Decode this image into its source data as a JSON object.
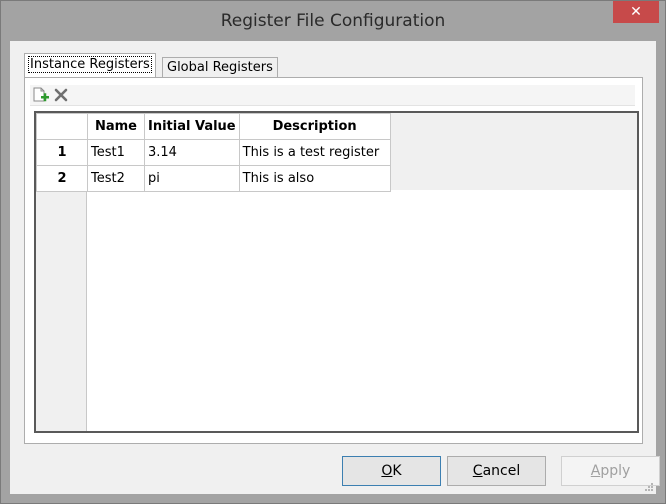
{
  "window": {
    "title": "Register File Configuration",
    "close_glyph": "✕"
  },
  "tabs": [
    {
      "label": "Instance Registers",
      "active": true
    },
    {
      "label": "Global Registers",
      "active": false
    }
  ],
  "toolbar": {
    "add_icon": "add-row-icon",
    "delete_icon": "delete-row-icon"
  },
  "grid": {
    "columns": [
      "Name",
      "Initial Value",
      "Description"
    ],
    "rows": [
      {
        "num": "1",
        "name": "Test1",
        "initial_value": "3.14",
        "description": "This is a test register"
      },
      {
        "num": "2",
        "name": "Test2",
        "initial_value": "pi",
        "description": "This is also"
      }
    ]
  },
  "buttons": {
    "ok": {
      "mnemonic": "O",
      "rest": "K"
    },
    "cancel": {
      "mnemonic": "C",
      "rest": "ancel"
    },
    "apply": {
      "mnemonic": "A",
      "rest": "pply"
    }
  },
  "colors": {
    "close_red": "#c74a4a",
    "default_button_border": "#3c7fb1"
  }
}
